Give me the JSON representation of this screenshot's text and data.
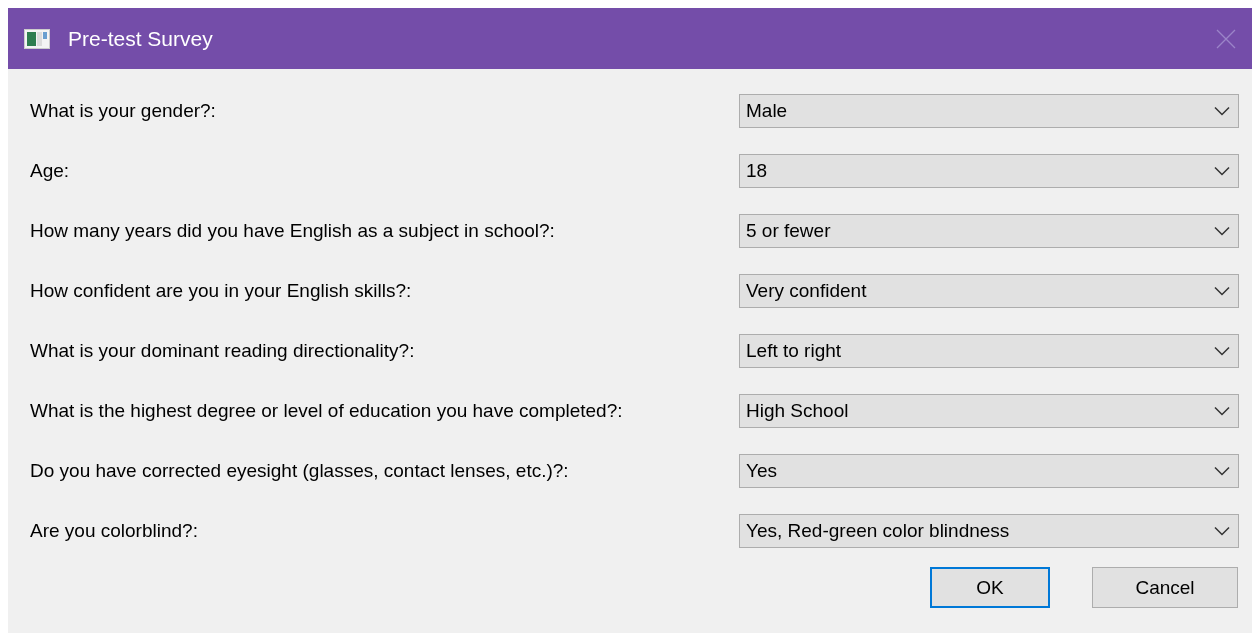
{
  "window": {
    "title": "Pre-test Survey"
  },
  "questions": [
    {
      "label": "What is your gender?:",
      "value": "Male"
    },
    {
      "label": "Age:",
      "value": "18"
    },
    {
      "label": "How many years did you have English as a subject in school?:",
      "value": "5 or fewer"
    },
    {
      "label": "How confident are you in your English skills?:",
      "value": "Very confident"
    },
    {
      "label": "What is your dominant reading directionality?:",
      "value": "Left to right"
    },
    {
      "label": "What is the highest degree or level of education you have completed?:",
      "value": "High School"
    },
    {
      "label": "Do you have corrected eyesight (glasses, contact lenses, etc.)?:",
      "value": "Yes"
    },
    {
      "label": "Are you colorblind?:",
      "value": "Yes, Red-green color blindness"
    }
  ],
  "buttons": [
    {
      "label": "OK",
      "default": true
    },
    {
      "label": "Cancel",
      "default": false
    }
  ]
}
